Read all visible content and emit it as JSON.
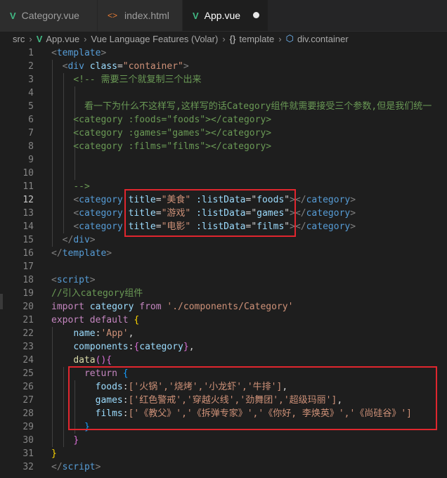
{
  "tabs": [
    {
      "label": "Category.vue",
      "icon": "vue-file-icon"
    },
    {
      "label": "index.html",
      "icon": "html-file-icon"
    },
    {
      "label": "App.vue",
      "icon": "vue-file-icon",
      "active": true,
      "modified": true
    }
  ],
  "breadcrumb": [
    "src",
    "App.vue",
    "Vue Language Features (Volar)",
    "template",
    "div.container"
  ],
  "editor": {
    "active_line": 12,
    "line_numbers": [
      "1",
      "2",
      "3",
      "4",
      "5",
      "6",
      "7",
      "8",
      "9",
      "10",
      "11",
      "12",
      "13",
      "14",
      "15",
      "16",
      "17",
      "18",
      "19",
      "20",
      "21",
      "22",
      "23",
      "24",
      "25",
      "26",
      "27",
      "28",
      "29",
      "30",
      "31",
      "32"
    ]
  },
  "code": {
    "l2_class": "container",
    "l3_comment": "<!-- 需要三个就复制三个出来",
    "l5_comment": "看一下为什么不这样写,这样写的话Category组件就需要接受三个参数,但是我们统一",
    "l6": {
      "attr": ":foods",
      "val": "\"foods\""
    },
    "l7": {
      "attr": ":games",
      "val": "\"games\""
    },
    "l8": {
      "attr": ":films",
      "val": "\"films\""
    },
    "l11_comment": "-->",
    "l12": {
      "title": "\"美食\"",
      "data": "\"foods\""
    },
    "l13": {
      "title": "\"游戏\"",
      "data": "\"games\""
    },
    "l14": {
      "title": "\"电影\"",
      "data": "\"films\""
    },
    "l19_comment": "//引入category组件",
    "l20_path": "'./components/Category'",
    "l22_name": "'App'",
    "l26": "['火锅','烧烤','小龙虾','牛排']",
    "l27": "['红色警戒','穿越火线','劲舞团','超级玛丽']",
    "l28": "['《教父》','《拆弹专家》','《你好, 李焕英》','《尚硅谷》']"
  }
}
